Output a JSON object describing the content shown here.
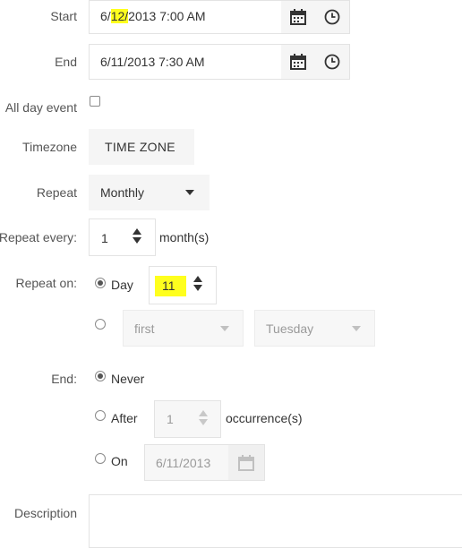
{
  "start": {
    "label": "Start",
    "value_prefix": "6/",
    "value_hl": "12/",
    "value_suffix": "2013 7:00 AM",
    "icons": [
      "calendar-icon",
      "clock-icon"
    ]
  },
  "end": {
    "label": "End",
    "value": "6/11/2013 7:30 AM",
    "icons": [
      "calendar-icon",
      "clock-icon"
    ]
  },
  "all_day": {
    "label": "All day event",
    "checked": false
  },
  "timezone": {
    "label": "Timezone",
    "button": "TIME ZONE"
  },
  "repeat": {
    "label": "Repeat",
    "value": "Monthly"
  },
  "repeat_every": {
    "label": "Repeat every:",
    "value": "1",
    "unit": "month(s)"
  },
  "repeat_on": {
    "label": "Repeat on:",
    "day_label": "Day",
    "day_value": "11",
    "week_choice": "first",
    "weekday_choice": "Tuesday",
    "selected": "day"
  },
  "end_rule": {
    "label": "End:",
    "never_label": "Never",
    "after_label": "After",
    "after_value": "1",
    "after_unit": "occurrence(s)",
    "on_label": "On",
    "on_value": "6/11/2013",
    "selected": "never"
  },
  "description": {
    "label": "Description",
    "value": ""
  },
  "colors": {
    "highlight": "#ffff1e",
    "border": "#e3e3e3",
    "disabled_bg": "#f7f7f7"
  }
}
